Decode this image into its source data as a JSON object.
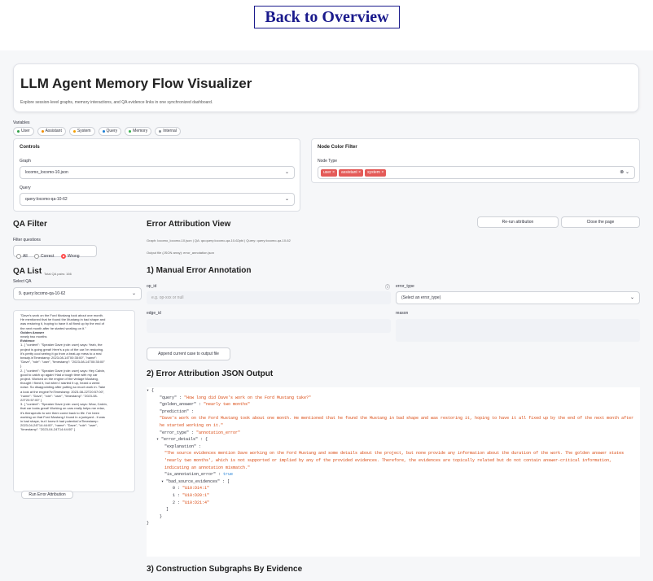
{
  "top": {
    "back_link": "Back to Overview"
  },
  "header": {
    "title": "LLM Agent Memory Flow Visualizer",
    "subtitle": "Explore session-level graphs, memory interactions, and QA evidence links in one synchronized dashboard."
  },
  "variables": {
    "label": "Variables",
    "chips": [
      {
        "label": "User",
        "color": "#2f9e44"
      },
      {
        "label": "Assistant",
        "color": "#f08c00"
      },
      {
        "label": "System",
        "color": "#f59f00"
      },
      {
        "label": "Query",
        "color": "#1c7ed6"
      },
      {
        "label": "Memory",
        "color": "#37b24d"
      },
      {
        "label": "Internal",
        "color": "#868e96"
      }
    ]
  },
  "controls": {
    "title": "Controls",
    "graph_label": "Graph",
    "graph_value": "locomo_locomo-10.json",
    "query_label": "Query",
    "query_value": "query:locomo-qa-10-62"
  },
  "node_filter": {
    "title": "Node Color Filter",
    "type_label": "Node Type",
    "tags": [
      "user",
      "assistant",
      "system"
    ]
  },
  "qa_filter": {
    "title": "QA Filter",
    "label": "Filter questions",
    "options": [
      "All",
      "Correct",
      "Wrong"
    ],
    "selected": "Wrong"
  },
  "qa_list": {
    "title": "QA List",
    "total": "Total QA pairs: 166",
    "select_label": "Select QA",
    "select_value": "9. query:locomo-qa-10-62",
    "content_lines": [
      "\"Dave's work on the Ford Mustang took about one month.",
      "He mentioned that he found the Mustang in bad shape and",
      "was restoring it, hoping to have it all fixed up by the end of",
      "the next month after he started working on it.\""
    ],
    "golden_label": "Golden Answer",
    "golden_value": "nearly two months",
    "evidence_label": "Evidence",
    "evidence_lines": [
      "1. { \"content\": \"Speaker Dave (role: user) says: Yeah, the",
      "project is going great! Here's a pic of the car I'm restoring.",
      "It's pretty cool seeing it go from a beat-up mess to a real",
      "beauty.\\nTimestamp: 2023-08-14T00:35:00\", \"name\":",
      "\"Dave\", \"role\": \"user\", \"timestamp\": \"2023-08-14T00:35:00\"",
      "}",
      "2. { \"content\": \"Speaker Dave (role: user) says: Hey Calvin,",
      "good to catch up again! Had a tough time with my car",
      "project. Worked on the engine of the vintage Mustang,",
      "thought I fixed it, but when I started it up, heard a weird",
      "noise. So disappointing after putting so much work in. Take",
      "a look at the engine?\\nTimestamp: 2023-08-22T20:57:00\",",
      "\"name\": \"Dave\", \"role\": \"user\", \"timestamp\": \"2023-08-",
      "22T20:57:00\" }",
      "3. { \"content\": \"Speaker Dave (role: user) says: Wow, Calvin,",
      "that car looks great! Working on cars really helps me relax,",
      "it's therapeutic to see them come back to life. I've been",
      "working on that Ford Mustang I found in a junkyard - it was",
      "in bad shape, but I knew it had potential.\\nTimestamp:",
      "2023-04-24T14:44:00\", \"name\": \"Dave\", \"role\": \"user\",",
      "\"timestamp\": \"2023-04-24T14:44:00\" }"
    ],
    "run_button": "Run Error Attribution"
  },
  "attribution": {
    "title": "Error Attribution View",
    "rerun_button": "Re-run attribution",
    "close_button": "Close the page",
    "meta_line1": "Graph: locomo_locomo-10.json | QA: qa:query:locomo-qa-10-62pbi | Query: query:locomo-qa-10-62",
    "meta_line2": "Output file (JSON array): error_annotation.json"
  },
  "manual": {
    "title": "1) Manual Error Annotation",
    "op_id_label": "op_id",
    "op_id_placeholder": "e.g. op-xxx or null",
    "error_type_label": "error_type",
    "error_type_value": "(Select an error_type)",
    "edge_id_label": "edge_id",
    "reason_label": "reason",
    "append_button": "Append current case to output file"
  },
  "json_output": {
    "title": "2) Error Attribution JSON Output",
    "query": "\"How long did Dave's work on the Ford Mustang take?\"",
    "golden_answer": "\"nearly two months\"",
    "prediction": "\"Dave's work on the Ford Mustang took about one month. He mentioned that he found the Mustang in bad shape and was restoring it, hoping to have it all fixed up by the end of the next month after he started working on it.\"",
    "error_type": "\"annotation_error\"",
    "explanation": "\"The source evidences mention Dave working on the Ford Mustang and some details about the project, but none provide any information about the duration of the work. The golden answer states 'nearly two months', which is not supported or implied by any of the provided evidences. Therefore, the evidences are topically related but do not contain answer-critical information, indicating an annotation mismatch.\"",
    "is_annotation_error": "true",
    "bad_source_evidences": [
      "\"U10:D14:1\"",
      "\"U10:D20:1\"",
      "\"U10:D21:4\""
    ]
  },
  "subgraphs": {
    "title": "3) Construction Subgraphs By Evidence"
  }
}
